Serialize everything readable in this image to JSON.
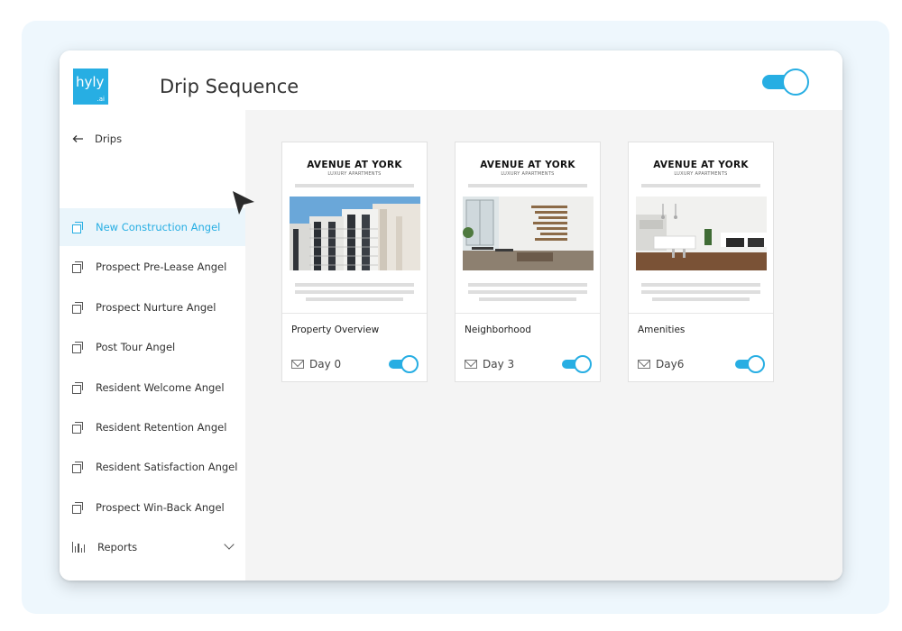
{
  "app": {
    "logo_text": "hyly",
    "logo_sub": ".ai",
    "title": "Drip Sequence",
    "master_toggle_on": true,
    "accent_color": "#27aee3"
  },
  "sidebar": {
    "back_label": "Drips",
    "items": [
      {
        "label": "New Construction Angel",
        "icon": "copy-icon",
        "active": true
      },
      {
        "label": "Prospect Pre-Lease Angel",
        "icon": "copy-icon",
        "active": false
      },
      {
        "label": "Prospect Nurture Angel",
        "icon": "copy-icon",
        "active": false
      },
      {
        "label": "Post Tour Angel",
        "icon": "copy-icon",
        "active": false
      },
      {
        "label": "Resident Welcome Angel",
        "icon": "copy-icon",
        "active": false
      },
      {
        "label": "Resident Retention Angel",
        "icon": "copy-icon",
        "active": false
      },
      {
        "label": "Resident Satisfaction Angel",
        "icon": "copy-icon",
        "active": false
      },
      {
        "label": "Prospect Win-Back Angel",
        "icon": "copy-icon",
        "active": false
      },
      {
        "label": "Reports",
        "icon": "bar-chart-icon",
        "active": false
      }
    ]
  },
  "cards": [
    {
      "brand": "AVENUE AT YORK",
      "brand_sub": "LUXURY APARTMENTS",
      "title": "Property Overview",
      "day": "Day 0",
      "enabled": true,
      "photo": "building-exterior"
    },
    {
      "brand": "AVENUE AT YORK",
      "brand_sub": "LUXURY APARTMENTS",
      "title": "Neighborhood",
      "day": "Day 3",
      "enabled": true,
      "photo": "lobby-interior"
    },
    {
      "brand": "AVENUE AT YORK",
      "brand_sub": "LUXURY APARTMENTS",
      "title": "Amenities",
      "day": "Day6",
      "enabled": true,
      "photo": "kitchen-interior"
    }
  ]
}
